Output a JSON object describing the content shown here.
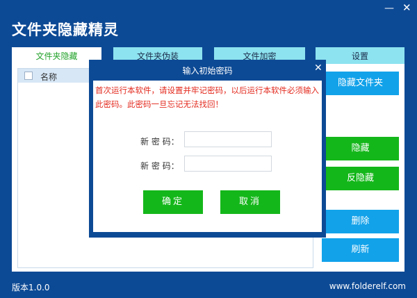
{
  "app": {
    "title": "文件夹隐藏精灵",
    "minimize_glyph": "—",
    "close_glyph": "✕"
  },
  "tabs": [
    {
      "label": "文件夹隐藏",
      "active": true
    },
    {
      "label": "文件夹伪装",
      "active": false
    },
    {
      "label": "文件加密",
      "active": false
    },
    {
      "label": "设置",
      "active": false
    }
  ],
  "list": {
    "columns": [
      "名称"
    ],
    "rows": []
  },
  "side_buttons": {
    "hide_folder": "隐藏文件夹",
    "hide": "隐藏",
    "unhide": "反隐藏",
    "delete": "删除",
    "refresh": "刷新"
  },
  "footer": {
    "version": "版本1.0.0",
    "website": "www.folderelf.com"
  },
  "dialog": {
    "title": "输入初始密码",
    "close_glyph": "✕",
    "message": "首次运行本软件，请设置并牢记密码，以后运行本软件必须输入此密码。此密码一旦忘记无法找回！",
    "new_password_label": "新 密 码：",
    "confirm_password_label": "新 密 码：",
    "new_password_value": "",
    "confirm_password_value": "",
    "ok_label": "确定",
    "cancel_label": "取消"
  },
  "colors": {
    "window_bg": "#0d4a95",
    "tab_inactive": "#8de3f0",
    "tab_active_text": "#22a22a",
    "accent_blue": "#12a2ea",
    "accent_green": "#14b71a",
    "warning_red": "#e32a1e"
  }
}
